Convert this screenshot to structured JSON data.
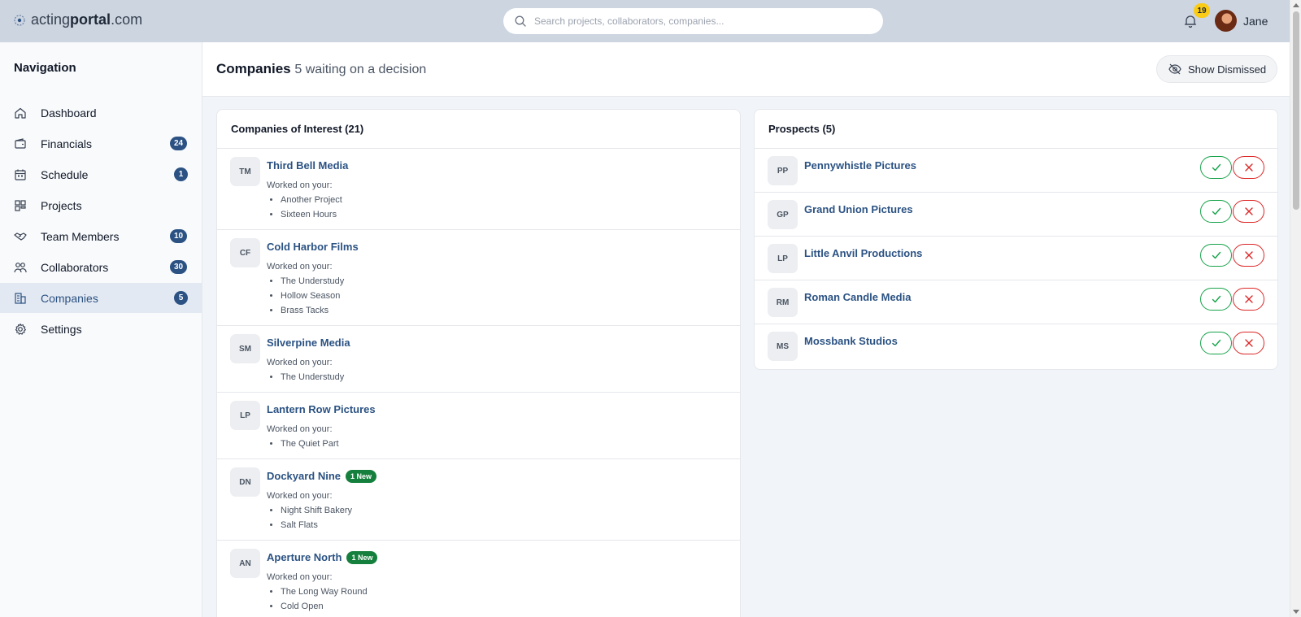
{
  "app": {
    "logo_prefix": "acting",
    "logo_bold": "portal",
    "logo_suffix": ".com"
  },
  "header": {
    "search_placeholder": "Search projects, collaborators, companies...",
    "notifications_count": "19",
    "user_name": "Jane"
  },
  "sidebar": {
    "title": "Navigation",
    "items": [
      {
        "label": "Dashboard",
        "icon": "home-icon",
        "badge": ""
      },
      {
        "label": "Financials",
        "icon": "wallet-icon",
        "badge": "24"
      },
      {
        "label": "Schedule",
        "icon": "calendar-icon",
        "badge": "1"
      },
      {
        "label": "Projects",
        "icon": "grid-icon",
        "badge": ""
      },
      {
        "label": "Team Members",
        "icon": "handshake-icon",
        "badge": "10"
      },
      {
        "label": "Collaborators",
        "icon": "users-icon",
        "badge": "30"
      },
      {
        "label": "Companies",
        "icon": "building-icon",
        "badge": "5",
        "active": true
      },
      {
        "label": "Settings",
        "icon": "gear-icon",
        "badge": ""
      }
    ]
  },
  "page": {
    "title": "Companies",
    "subtitle": "5 waiting on a decision",
    "dismissed_button": "Show Dismissed"
  },
  "companies_of_interest": {
    "title": "Companies of Interest (21)",
    "worked_label": "Worked on your:",
    "rows": [
      {
        "initials": "TM",
        "name": "Third Bell Media",
        "badge": "",
        "projects": [
          "Another Project",
          "Sixteen Hours"
        ]
      },
      {
        "initials": "CF",
        "name": "Cold Harbor Films",
        "badge": "",
        "projects": [
          "The Understudy",
          "Hollow Season",
          "Brass Tacks"
        ]
      },
      {
        "initials": "SM",
        "name": "Silverpine Media",
        "badge": "",
        "projects": [
          "The Understudy"
        ]
      },
      {
        "initials": "LP",
        "name": "Lantern Row Pictures",
        "badge": "",
        "projects": [
          "The Quiet Part"
        ]
      },
      {
        "initials": "DN",
        "name": "Dockyard Nine",
        "badge": "1 New",
        "projects": [
          "Night Shift Bakery",
          "Salt Flats"
        ]
      },
      {
        "initials": "AN",
        "name": "Aperture North",
        "badge": "1 New",
        "projects": [
          "The Long Way Round",
          "Cold Open"
        ]
      }
    ]
  },
  "prospects": {
    "title": "Prospects (5)",
    "rows": [
      {
        "initials": "PP",
        "name": "Pennywhistle Pictures"
      },
      {
        "initials": "GP",
        "name": "Grand Union Pictures"
      },
      {
        "initials": "LP",
        "name": "Little Anvil Productions"
      },
      {
        "initials": "RM",
        "name": "Roman Candle Media"
      },
      {
        "initials": "MS",
        "name": "Mossbank Studios"
      }
    ]
  },
  "colors": {
    "topbar": "#ccd5e0",
    "accent": "#2b5283",
    "badge_yellow": "#facc15",
    "new_green": "#15803d",
    "accept_green": "#16a34a",
    "reject_red": "#dc2626"
  }
}
